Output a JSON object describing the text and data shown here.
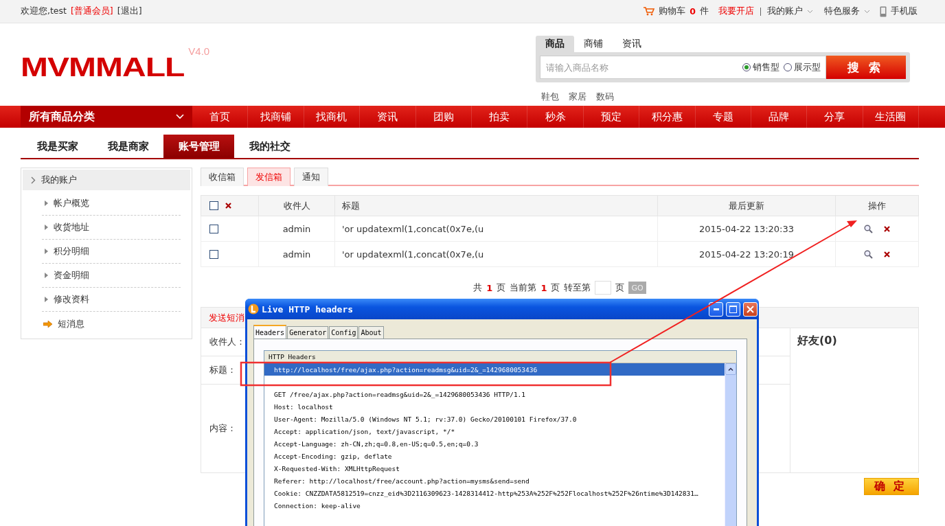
{
  "top_bar": {
    "welcome": "欢迎您,test",
    "member_level": "[普通会员]",
    "logout": "[退出]",
    "cart_label": "购物车",
    "cart_count": "0",
    "cart_unit": "件",
    "open_shop": "我要开店",
    "my_account": "我的账户",
    "special_services": "特色服务",
    "mobile": "手机版"
  },
  "logo": {
    "text": "MVMMALL",
    "version": "V4.0"
  },
  "search": {
    "tabs": [
      {
        "label": "商品",
        "selected": true
      },
      {
        "label": "商铺",
        "selected": false
      },
      {
        "label": "资讯",
        "selected": false
      }
    ],
    "placeholder": "请输入商品名称",
    "types": [
      {
        "label": "销售型",
        "selected": true
      },
      {
        "label": "展示型",
        "selected": false
      }
    ],
    "button": "搜索",
    "hot_words": [
      "鞋包",
      "家居",
      "数码"
    ]
  },
  "nav": {
    "category": "所有商品分类",
    "items": [
      "首页",
      "找商铺",
      "找商机",
      "资讯",
      "团购",
      "拍卖",
      "秒杀",
      "预定",
      "积分惠",
      "专题",
      "品牌",
      "分享",
      "生活圈"
    ]
  },
  "account_tabs": [
    {
      "label": "我是买家",
      "selected": false
    },
    {
      "label": "我是商家",
      "selected": false
    },
    {
      "label": "账号管理",
      "selected": true
    },
    {
      "label": "我的社交",
      "selected": false
    }
  ],
  "sidebar": {
    "title": "我的账户",
    "items": [
      {
        "label": "帐户概览",
        "selected": false
      },
      {
        "label": "收货地址",
        "selected": false
      },
      {
        "label": "积分明细",
        "selected": false
      },
      {
        "label": "资金明细",
        "selected": false
      },
      {
        "label": "修改资料",
        "selected": false
      },
      {
        "label": "短消息",
        "selected": true
      }
    ]
  },
  "message_tabs": [
    {
      "label": "收信箱",
      "selected": false
    },
    {
      "label": "发信箱",
      "selected": true
    },
    {
      "label": "通知",
      "selected": false
    }
  ],
  "table": {
    "columns": [
      "收件人",
      "标题",
      "最后更新",
      "操作"
    ],
    "all_checked": false,
    "rows": [
      {
        "checked": false,
        "recipient": "admin",
        "title": "'or updatexml(1,concat(0x7e,(u",
        "updated": "2015-04-22 13:20:33"
      },
      {
        "checked": false,
        "recipient": "admin",
        "title": "'or updatexml(1,concat(0x7e,(u",
        "updated": "2015-04-22 13:20:19"
      }
    ]
  },
  "pagination": {
    "total_prefix": "共",
    "total": "1",
    "total_unit": "页",
    "current_prefix": "当前第",
    "current": "1",
    "current_unit": "页",
    "goto_prefix": "转至第",
    "goto_unit": "页",
    "go": "GO"
  },
  "compose": {
    "title": "发送短消",
    "fields": [
      {
        "label": "收件人："
      },
      {
        "label": "标题："
      },
      {
        "label": "内容："
      }
    ],
    "friends": "好友(0)",
    "submit": "确定"
  },
  "dialog": {
    "title": "Live HTTP headers",
    "tabs": [
      {
        "label": "Headers",
        "selected": true
      },
      {
        "label": "Generator",
        "selected": false
      },
      {
        "label": "Config",
        "selected": false
      },
      {
        "label": "About",
        "selected": false
      }
    ],
    "list_header": "HTTP Headers",
    "selected_url": "http://localhost/free/ajax.php?action=readmsg&uid=2&_=1429680053436",
    "lines": [
      "GET /free/ajax.php?action=readmsg&uid=2&_=1429680053436 HTTP/1.1",
      "Host: localhost",
      "User-Agent: Mozilla/5.0 (Windows NT 5.1; rv:37.0) Gecko/20100101 Firefox/37.0",
      "Accept: application/json, text/javascript, */*",
      "Accept-Language: zh-CN,zh;q=0.8,en-US;q=0.5,en;q=0.3",
      "Accept-Encoding: gzip, deflate",
      "X-Requested-With: XMLHttpRequest",
      "Referer: http://localhost/free/account.php?action=mysms&send=send",
      "Cookie: CNZZDATA5812519=cnzz_eid%3D2116309623-1428314412-http%253A%252F%252Flocalhost%252F%26ntime%3D142831…",
      "Connection: keep-alive"
    ]
  }
}
